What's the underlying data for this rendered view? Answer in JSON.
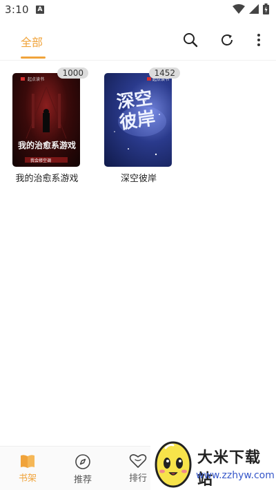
{
  "status_bar": {
    "time": "3:10",
    "notif": "A"
  },
  "top_bar": {
    "tab_label": "全部",
    "accent_color": "#f0a33a",
    "icons": [
      "search-icon",
      "refresh-icon",
      "more-vertical-icon"
    ]
  },
  "books": [
    {
      "title": "我的治愈系游戏",
      "badge": "1000",
      "cover_text": "我的治愈系游戏",
      "cover_publisher": "起点读书",
      "cover_author": "我会修空调"
    },
    {
      "title": "深空彼岸",
      "badge": "1452",
      "cover_text": "深空彼岸",
      "cover_publisher": "起点读书"
    }
  ],
  "bottom_nav": [
    {
      "label": "书架",
      "icon": "book-icon",
      "active": true
    },
    {
      "label": "推荐",
      "icon": "compass-icon",
      "active": false
    },
    {
      "label": "排行",
      "icon": "heart-icon",
      "active": false
    }
  ],
  "watermark": {
    "title": "大米下载站",
    "url": "www.zzhyw.com"
  }
}
